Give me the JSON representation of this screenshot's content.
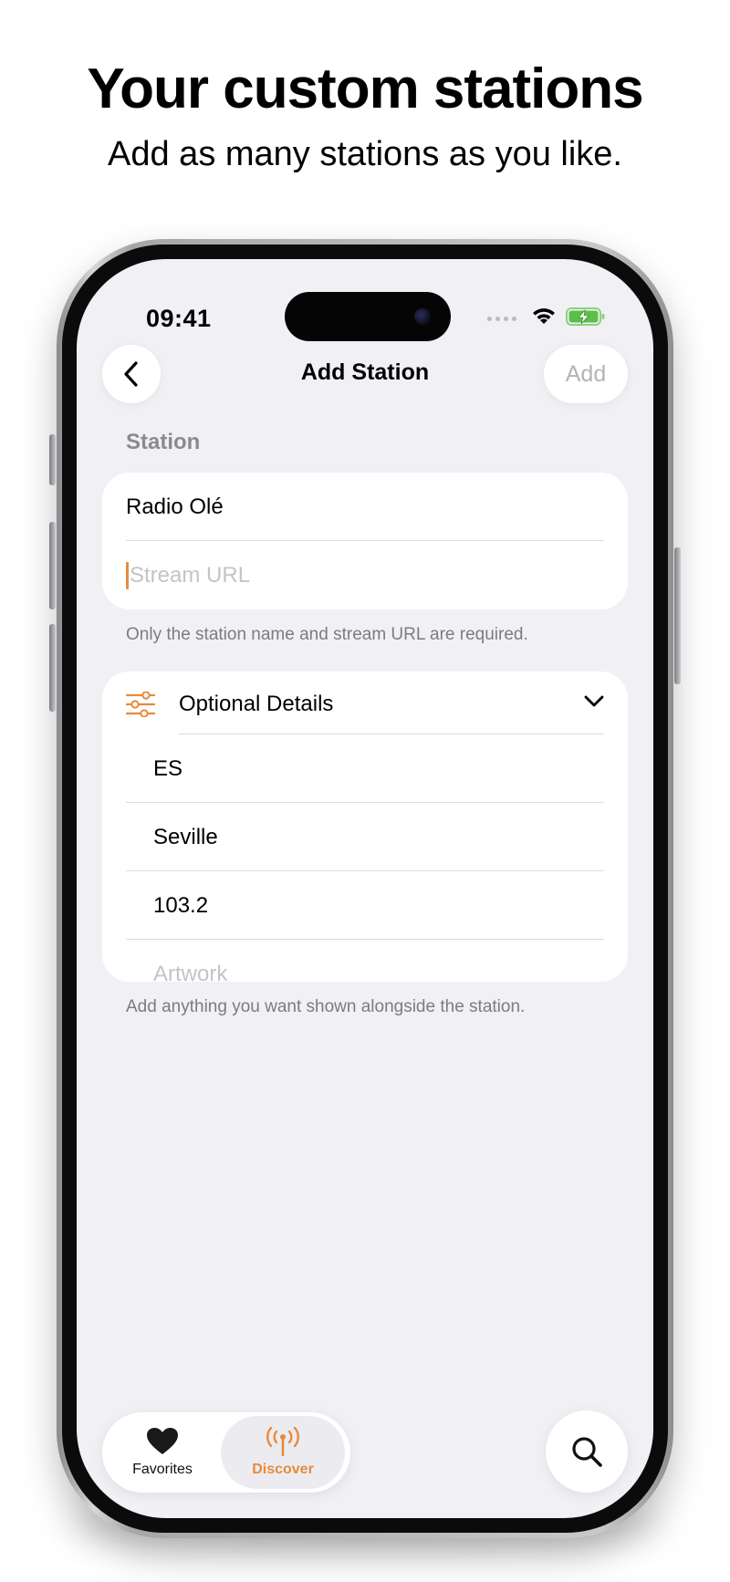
{
  "promo": {
    "headline": "Your custom stations",
    "subhead": "Add as many stations as you like."
  },
  "status_bar": {
    "time": "09:41"
  },
  "nav": {
    "title": "Add Station",
    "add_label": "Add",
    "back_icon": "chevron-left-icon"
  },
  "station_section": {
    "label": "Station",
    "name_value": "Radio Olé",
    "stream_url_placeholder": "Stream URL",
    "footnote": "Only the station name and stream URL are required."
  },
  "optional_section": {
    "header_label": "Optional Details",
    "header_icon": "sliders-icon",
    "expand_icon": "chevron-down-icon",
    "country_value": "ES",
    "city_value": "Seville",
    "frequency_value": "103.2",
    "artwork_placeholder": "Artwork",
    "footnote": "Add anything you want shown alongside the station."
  },
  "tabbar": {
    "favorites_label": "Favorites",
    "discover_label": "Discover"
  },
  "colors": {
    "accent": "#E88A3D",
    "background": "#F1F1F5",
    "card": "#FFFFFF",
    "secondary_text": "#8A8A8F",
    "placeholder": "#C4C4C8"
  }
}
